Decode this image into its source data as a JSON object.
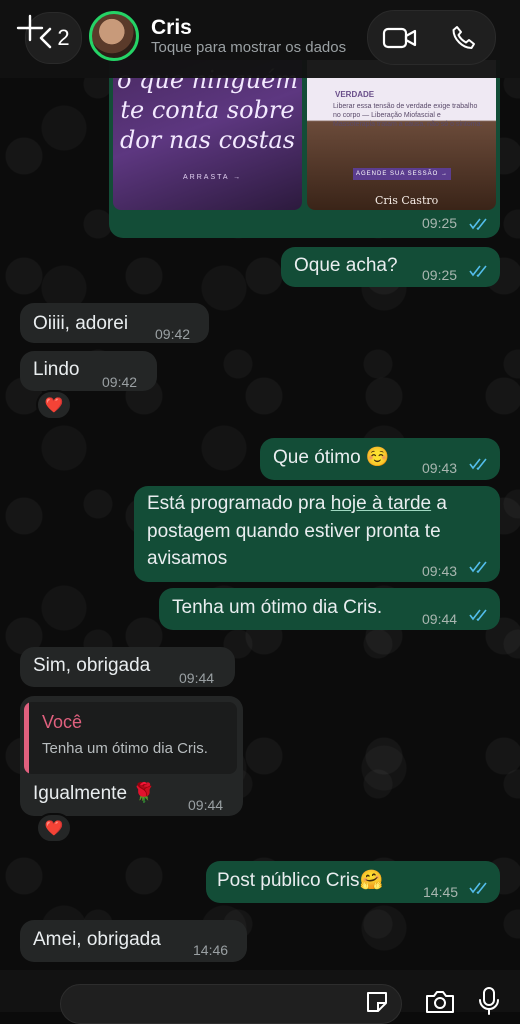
{
  "header": {
    "back_count": "2",
    "contact_name": "Cris",
    "contact_subtitle": "Toque para mostrar os dados"
  },
  "shared_image": {
    "left_text_line1": "o que ninguém",
    "left_text_line2": "te conta sobre",
    "left_text_line3": "dor nas costas",
    "left_small": "ARRASTA →",
    "right_label": "VERDADE",
    "right_paragraph": "Liberar essa tensão de verdade exige trabalho no corpo — Liberação Miofascial e Massoterapia tratam a causa, não só o sintoma.",
    "right_cta": "AGENDE SUA SESSÃO →",
    "right_brand": "Cris Castro",
    "time": "09:25"
  },
  "messages": [
    {
      "text": "Oque acha?",
      "time": "09:25"
    },
    {
      "text": "Oiiii, adorei",
      "time": "09:42"
    },
    {
      "text": "Lindo",
      "time": "09:42",
      "reaction": "❤️"
    },
    {
      "text": "Que ótimo ☺️",
      "time": "09:43"
    },
    {
      "line1_pre": "Está programado pra ",
      "line1_link": "hoje à tarde",
      "line1_post": " a",
      "line2": "postagem quando estiver pronta te",
      "line3": "avisamos",
      "time": "09:43"
    },
    {
      "text": "Tenha um ótimo dia Cris.",
      "time": "09:44"
    },
    {
      "text": "Sim, obrigada",
      "time": "09:44"
    },
    {
      "quote_author": "Você",
      "quote_text": "Tenha um ótimo dia Cris.",
      "text": "Igualmente 🌹",
      "time": "09:44",
      "reaction": "❤️"
    },
    {
      "text": "Post público Cris🤗",
      "time": "14:45"
    },
    {
      "text": "Amei, obrigada",
      "time": "14:46"
    }
  ],
  "composer": {
    "value": "",
    "placeholder": ""
  },
  "colors": {
    "outgoing_bubble": "#134d37",
    "incoming_bubble": "#242626",
    "read_ticks": "#53bdeb",
    "online_ring": "#25d366"
  }
}
